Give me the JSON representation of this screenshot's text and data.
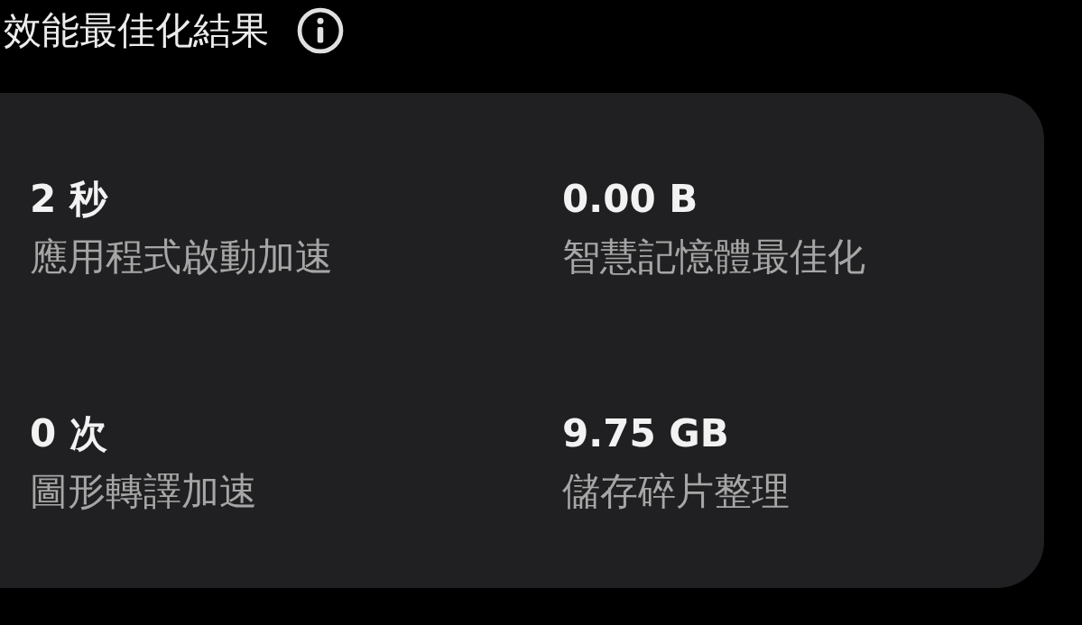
{
  "title": "效能最佳化結果",
  "stats": [
    {
      "value": "2 秒",
      "label": "應用程式啟動加速"
    },
    {
      "value": "0.00 B",
      "label": "智慧記憶體最佳化"
    },
    {
      "value": "0 次",
      "label": "圖形轉譯加速"
    },
    {
      "value": "9.75 GB",
      "label": "儲存碎片整理"
    }
  ]
}
